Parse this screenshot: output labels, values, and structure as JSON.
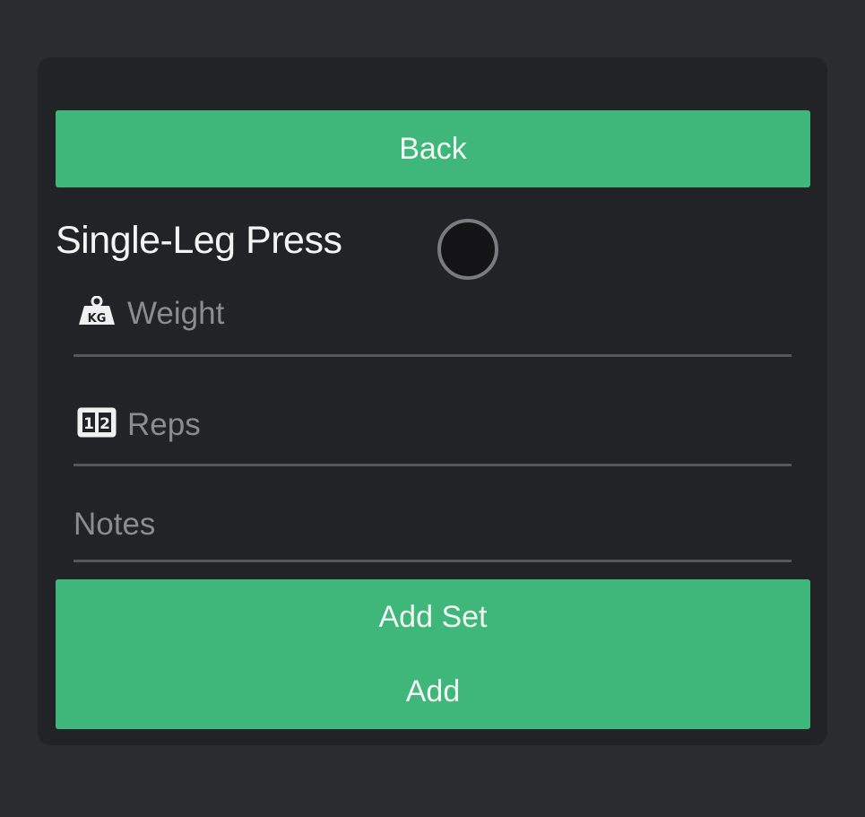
{
  "header": {
    "back_label": "Back"
  },
  "exercise": {
    "title": "Single-Leg Press"
  },
  "fields": {
    "weight": {
      "placeholder": "Weight",
      "icon": "kg-weight-icon"
    },
    "reps": {
      "placeholder": "Reps",
      "icon": "reps-counter-icon"
    },
    "notes": {
      "placeholder": "Notes"
    }
  },
  "actions": {
    "add_set_label": "Add Set",
    "add_label": "Add"
  },
  "colors": {
    "accent": "#3fb77b",
    "background": "#2b2c2f",
    "card": "#222326"
  }
}
